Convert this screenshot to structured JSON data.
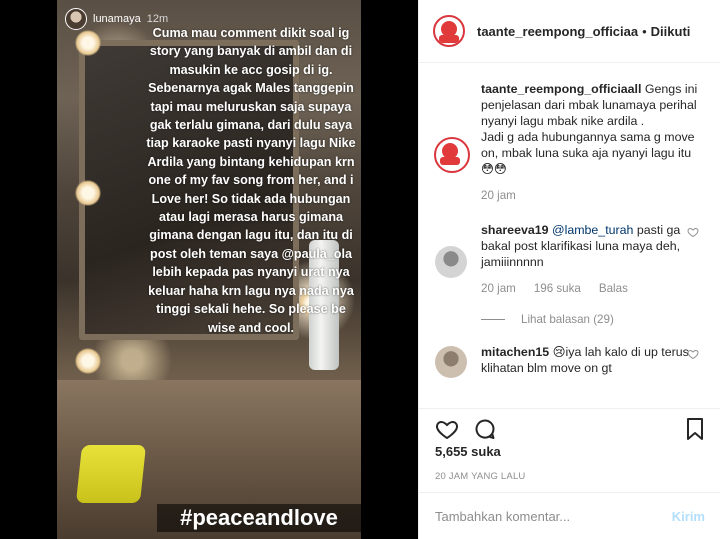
{
  "story": {
    "username": "lunamaya",
    "time": "12m",
    "text": "Cuma mau comment dikit soal ig story yang banyak di ambil dan di masukin ke acc gosip di ig. Sebenarnya agak Males tanggepin tapi mau meluruskan saja supaya gak terlalu gimana, dari dulu saya tiap karaoke pasti nyanyi lagu Nike Ardila yang bintang kehidupan krn one of my fav song from her, and i Love her! So tidak ada hubungan atau lagi merasa harus gimana gimana dengan lagu itu, dan itu di post oleh teman saya @paula_ola lebih kepada pas nyanyi urat nya keluar haha krn lagu nya nada nya tinggi sekali hehe. So please be wise and cool.",
    "hashtag": "#peaceandlove"
  },
  "header": {
    "username": "taante_reempong_officiaa",
    "separator": "•",
    "follow_label": "Diikuti"
  },
  "caption": {
    "username": "taante_reempong_officiaall",
    "text_1": " Gengs ini penjelasan dari mbak lunamaya perihal nyanyi lagu mbak nike ardila .",
    "text_2": "Jadi g ada hubungannya sama g move on, mbak luna suka aja nyanyi lagu itu 😳😳",
    "time": "20 jam"
  },
  "comments": [
    {
      "username": "shareeva19",
      "mention": "@lambe_turah",
      "text": " pasti ga bakal post klarifikasi luna maya deh, jamiiinnnnn",
      "time": "20 jam",
      "likes": "196 suka",
      "reply_label": "Balas"
    },
    {
      "username": "mitachen15",
      "text": " 😢iya lah kalo di up terus klihatan blm move on gt"
    }
  ],
  "view_replies": "Lihat balasan (29)",
  "likes_count": "5,655 suka",
  "post_date": "20 JAM YANG LALU",
  "comment_box": {
    "placeholder": "Tambahkan komentar...",
    "post_label": "Kirim"
  },
  "icons": {
    "like": "heart-icon",
    "comment": "comment-icon",
    "share": "share-icon",
    "save": "bookmark-icon"
  },
  "colors": {
    "link_blue": "#00376b",
    "post_button_disabled": "#b2dffc",
    "avatar_ring": "#d9363e"
  }
}
